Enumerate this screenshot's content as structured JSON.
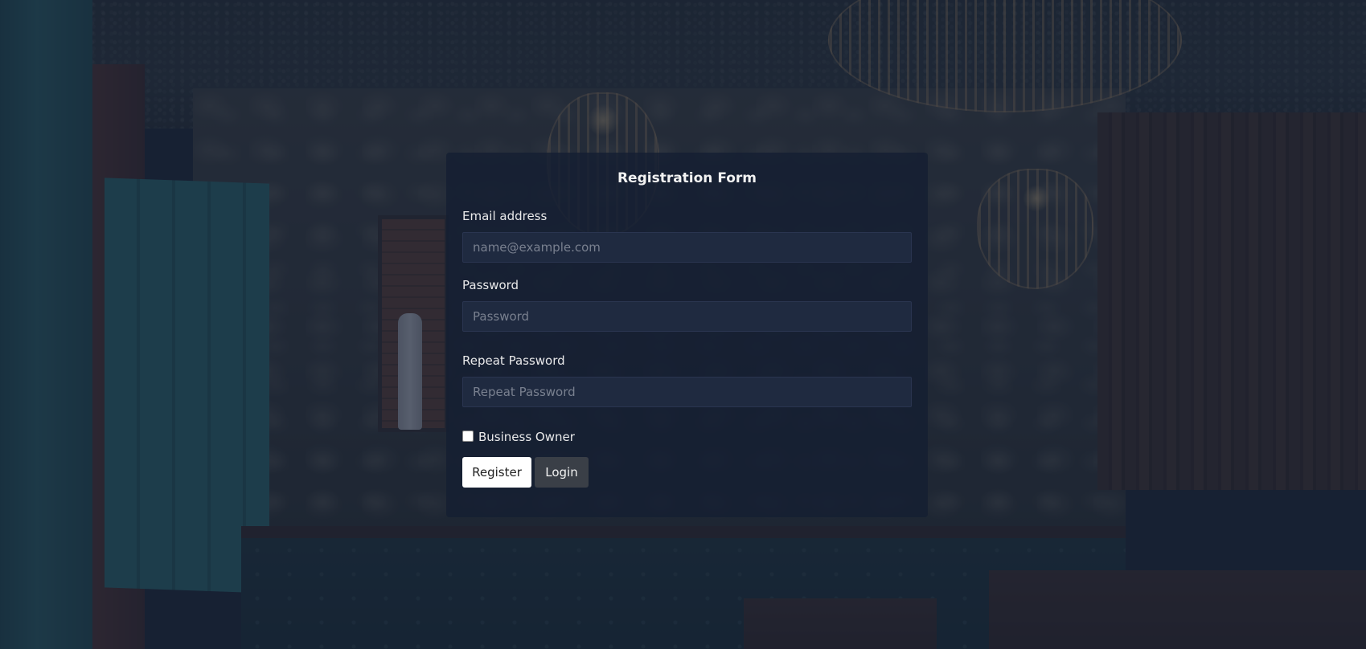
{
  "form": {
    "title": "Registration Form",
    "email": {
      "label": "Email address",
      "placeholder": "name@example.com",
      "value": ""
    },
    "password": {
      "label": "Password",
      "placeholder": "Password",
      "value": ""
    },
    "repeat_password": {
      "label": "Repeat Password",
      "placeholder": "Repeat Password",
      "value": ""
    },
    "business_owner": {
      "label": "Business Owner",
      "checked": false
    },
    "buttons": {
      "register": "Register",
      "login": "Login"
    }
  },
  "colors": {
    "card_background": "#151f32",
    "input_background": "#1f2a40",
    "register_button": "#ffffff",
    "login_button": "#3a3f47",
    "text": "#e9e9ea"
  }
}
